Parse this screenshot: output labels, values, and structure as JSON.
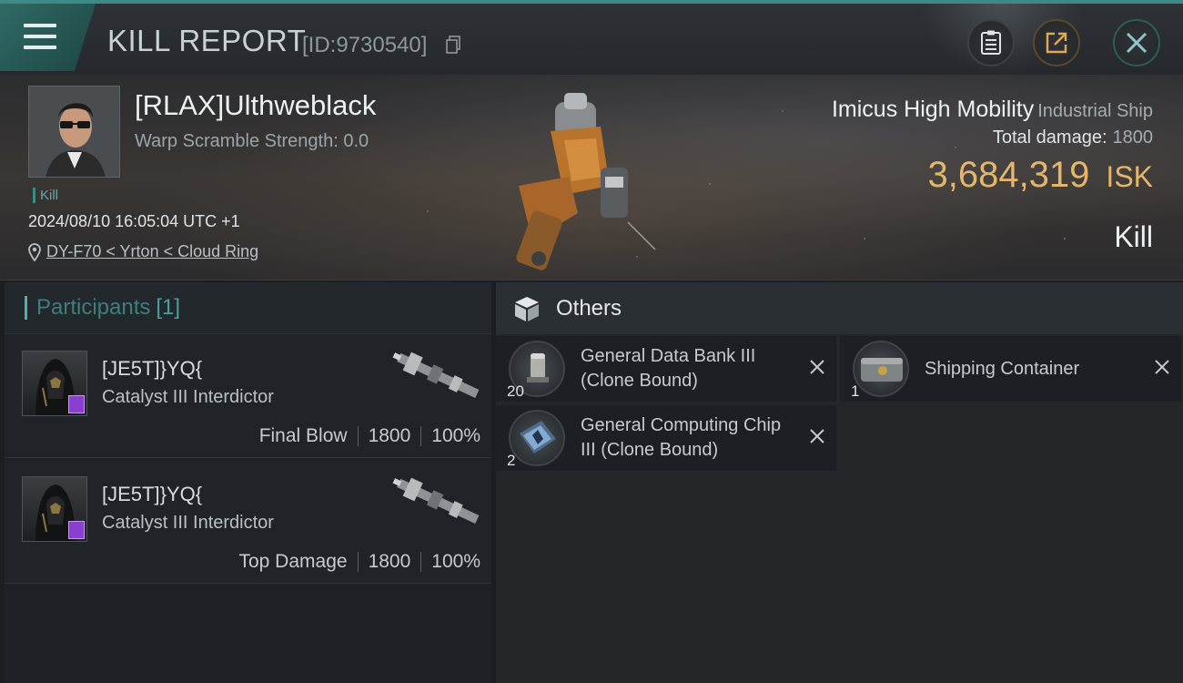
{
  "header": {
    "title": "KILL REPORT",
    "report_id": "[ID:9730540]"
  },
  "victim": {
    "name": "[RLAX]Ulthweblack",
    "warp_scramble": "Warp Scramble Strength: 0.0",
    "kill_tag": "Kill",
    "datetime": "2024/08/10 16:05:04 UTC +1",
    "location": "DY-F70 < Yrton < Cloud Ring"
  },
  "ship": {
    "name": "Imicus High Mobility",
    "class": "Industrial Ship",
    "total_damage_label": "Total damage:",
    "total_damage_value": "1800",
    "isk_value": "3,684,319",
    "isk_unit": "ISK",
    "result_label": "Kill"
  },
  "participants": {
    "label": "Participants",
    "count": "[1]",
    "rows": [
      {
        "name": "[JE5T]}YQ{",
        "ship": "Catalyst III Interdictor",
        "role": "Final Blow",
        "damage": "1800",
        "percent": "100%"
      },
      {
        "name": "[JE5T]}YQ{",
        "ship": "Catalyst III Interdictor",
        "role": "Top Damage",
        "damage": "1800",
        "percent": "100%"
      }
    ]
  },
  "others": {
    "label": "Others",
    "items": [
      {
        "qty": "20",
        "name": "General Data Bank III (Clone Bound)",
        "icon": "data-bank-icon"
      },
      {
        "qty": "1",
        "name": "Shipping Container",
        "icon": "container-icon"
      },
      {
        "qty": "2",
        "name": "General Computing Chip III (Clone Bound)",
        "icon": "chip-icon"
      }
    ]
  },
  "colors": {
    "accent": "#3d8a86",
    "isk": "#e3b66b"
  }
}
